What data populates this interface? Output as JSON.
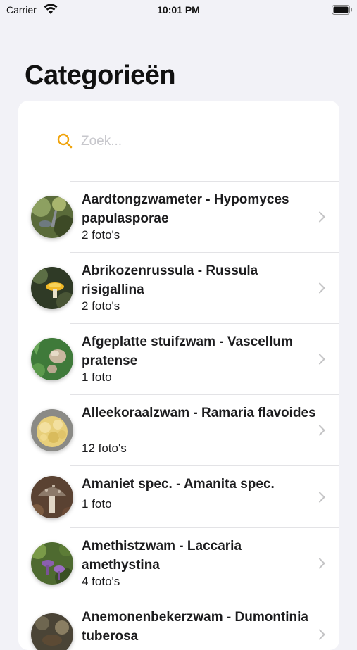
{
  "status_bar": {
    "carrier": "Carrier",
    "time": "10:01 PM"
  },
  "page": {
    "title": "Categorieën"
  },
  "search": {
    "placeholder": "Zoek...",
    "value": ""
  },
  "categories": [
    {
      "name": "Aardtongzwameter - Hypomyces papulasporae",
      "count": "2 foto's"
    },
    {
      "name": "Abrikozenrussula - Russula risigallina",
      "count": "2 foto's"
    },
    {
      "name": "Afgeplatte stuifzwam - Vascellum pratense",
      "count": "1 foto"
    },
    {
      "name": "Alleekoraalzwam - Ramaria flavoides",
      "count": "12 foto's"
    },
    {
      "name": "Amaniet spec. - Amanita spec.",
      "count": "1 foto"
    },
    {
      "name": "Amethistzwam - Laccaria amethystina",
      "count": "4 foto's"
    },
    {
      "name": "Anemonenbekerzwam - Dumontinia tuberosa",
      "count": ""
    }
  ],
  "colors": {
    "accent": "#f0a30a",
    "background": "#f2f2f7",
    "separator": "#e3e3e6",
    "chevron": "#c4c4c6"
  }
}
